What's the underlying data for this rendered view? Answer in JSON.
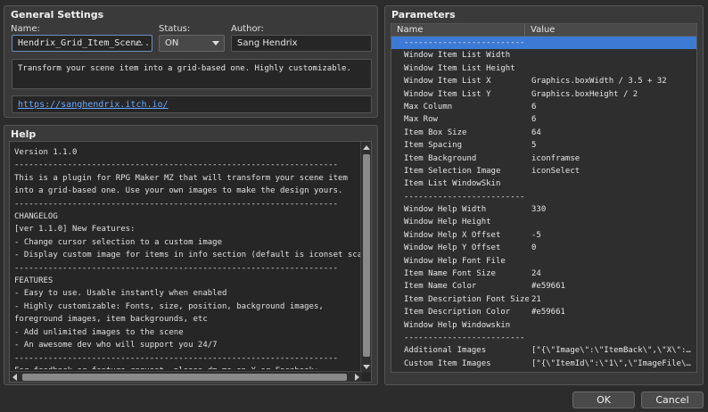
{
  "general": {
    "title": "General Settings",
    "name_label": "Name:",
    "name_value": "Hendrix_Grid_Item_Scene",
    "name_more": "...",
    "status_label": "Status:",
    "status_value": "ON",
    "author_label": "Author:",
    "author_value": "Sang Hendrix",
    "description": "Transform your scene item into a grid-based one. Highly customizable.",
    "url": "https://sanghendrix.itch.io/"
  },
  "help": {
    "title": "Help",
    "text": "Version 1.1.0\n-------------------------------------------------------------------\nThis is a plugin for RPG Maker MZ that will transform your scene item\ninto a grid-based one. Use your own images to make the design yours.\n-------------------------------------------------------------------\nCHANGELOG\n[ver 1.1.0] New Features:\n- Change cursor selection to a custom image\n- Display custom image for items in info section (default is iconset scaled u\n-------------------------------------------------------------------\nFEATURES\n- Easy to use. Usable instantly when enabled\n- Highly customizable: Fonts, size, position, background images,\nforeground images, item backgrounds, etc\n- Add unlimited images to the scene\n- An awesome dev who will support you 24/7\n-------------------------------------------------------------------\nFor feedback or feature request, please dm me on X or Facebook:"
  },
  "parameters": {
    "title": "Parameters",
    "col_name": "Name",
    "col_value": "Value",
    "rows": [
      {
        "name": "-------------------------",
        "value": ""
      },
      {
        "name": "Window Item List Width",
        "value": ""
      },
      {
        "name": "Window Item List Height",
        "value": ""
      },
      {
        "name": "Window Item List X",
        "value": "Graphics.boxWidth / 3.5 + 32"
      },
      {
        "name": "Window Item List Y",
        "value": "Graphics.boxHeight / 2"
      },
      {
        "name": "Max Column",
        "value": "6"
      },
      {
        "name": "Max Row",
        "value": "6"
      },
      {
        "name": "Item Box Size",
        "value": "64"
      },
      {
        "name": "Item Spacing",
        "value": "5"
      },
      {
        "name": "Item Background",
        "value": "iconframse"
      },
      {
        "name": "Item Selection Image",
        "value": "iconSelect"
      },
      {
        "name": "Item List WindowSkin",
        "value": ""
      },
      {
        "name": "-------------------------",
        "value": ""
      },
      {
        "name": "Window Help Width",
        "value": "330"
      },
      {
        "name": "Window Help Height",
        "value": ""
      },
      {
        "name": "Window Help X Offset",
        "value": "-5"
      },
      {
        "name": "Window Help Y Offset",
        "value": "0"
      },
      {
        "name": "Window Help Font File",
        "value": ""
      },
      {
        "name": "Item Name Font Size",
        "value": "24"
      },
      {
        "name": "Item Name Color",
        "value": "#e59661"
      },
      {
        "name": "Item Description Font Size",
        "value": "21"
      },
      {
        "name": "Item Description Color",
        "value": "#e59661"
      },
      {
        "name": "Window Help Windowskin",
        "value": ""
      },
      {
        "name": "-------------------------",
        "value": ""
      },
      {
        "name": "Additional Images",
        "value": "[\"{\\\"Image\\\":\\\"ItemBack\\\",\\\"X\\\":…"
      },
      {
        "name": "Custom Item Images",
        "value": "[\"{\\\"ItemId\\\":\\\"1\\\",\\\"ImageFile\\…"
      }
    ]
  },
  "buttons": {
    "ok": "OK",
    "cancel": "Cancel"
  },
  "colors": {
    "background": "#2c2c2c",
    "panel": "#3a3a3a",
    "selection": "#3d7ad6",
    "link": "#6aa8ff"
  }
}
